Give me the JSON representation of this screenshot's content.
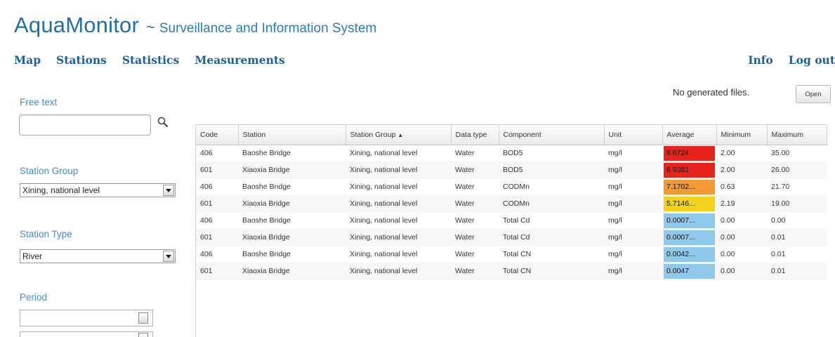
{
  "header": {
    "title": "AquaMonitor",
    "separator": "~",
    "subtitle": "Surveillance and Information System"
  },
  "nav": {
    "left": [
      "Map",
      "Stations",
      "Statistics",
      "Measurements"
    ],
    "right": [
      "Info",
      "Log out"
    ]
  },
  "sidebar": {
    "free_text": {
      "label": "Free text",
      "value": ""
    },
    "station_group": {
      "label": "Station Group",
      "value": "Xining, national level"
    },
    "station_type": {
      "label": "Station Type",
      "value": "River"
    },
    "period": {
      "label": "Period",
      "from": "",
      "to": ""
    }
  },
  "files": {
    "status": "No generated files.",
    "open_label": "Open"
  },
  "table": {
    "columns": [
      "Code",
      "Station",
      "Station Group",
      "Data type",
      "Component",
      "Unit",
      "Average",
      "Minimum",
      "Maximum"
    ],
    "sort_indicator": "▲",
    "rows": [
      {
        "code": "406",
        "station": "Baoshe Bridge",
        "group": "Xining, national level",
        "datatype": "Water",
        "component": "BOD5",
        "unit": "mg/l",
        "average": "9.6724",
        "avg_color": "#e8231b",
        "min": "2.00",
        "max": "35.00"
      },
      {
        "code": "601",
        "station": "Xiaoxia Bridge",
        "group": "Xining, national level",
        "datatype": "Water",
        "component": "BOD5",
        "unit": "mg/l",
        "average": "6.9381",
        "avg_color": "#e8231b",
        "min": "2.00",
        "max": "26.00"
      },
      {
        "code": "406",
        "station": "Baoshe Bridge",
        "group": "Xining, national level",
        "datatype": "Water",
        "component": "CODMn",
        "unit": "mg/l",
        "average": "7.1702...",
        "avg_color": "#f39a34",
        "min": "0.63",
        "max": "21.70"
      },
      {
        "code": "601",
        "station": "Xiaoxia Bridge",
        "group": "Xining, national level",
        "datatype": "Water",
        "component": "CODMn",
        "unit": "mg/l",
        "average": "5.7146...",
        "avg_color": "#f5d21c",
        "min": "2.19",
        "max": "19.00"
      },
      {
        "code": "406",
        "station": "Baoshe Bridge",
        "group": "Xining, national level",
        "datatype": "Water",
        "component": "Total Cd",
        "unit": "mg/l",
        "average": "0.0007...",
        "avg_color": "#8fcaec",
        "min": "0.00",
        "max": "0.00"
      },
      {
        "code": "601",
        "station": "Xiaoxia Bridge",
        "group": "Xining, national level",
        "datatype": "Water",
        "component": "Total Cd",
        "unit": "mg/l",
        "average": "0.0007...",
        "avg_color": "#8fcaec",
        "min": "0.00",
        "max": "0.01"
      },
      {
        "code": "406",
        "station": "Baoshe Bridge",
        "group": "Xining, national level",
        "datatype": "Water",
        "component": "Total CN",
        "unit": "mg/l",
        "average": "0.0042...",
        "avg_color": "#8fcaec",
        "min": "0.00",
        "max": "0.01"
      },
      {
        "code": "601",
        "station": "Xiaoxia Bridge",
        "group": "Xining, national level",
        "datatype": "Water",
        "component": "Total CN",
        "unit": "mg/l",
        "average": "0.0047",
        "avg_color": "#8fcaec",
        "min": "0.00",
        "max": "0.01"
      }
    ]
  },
  "colors": {
    "brand": "#1f6fa8",
    "nav": "#1f5f99",
    "label": "#3c8fc8",
    "level_high": "#e8231b",
    "level_elevated": "#f39a34",
    "level_moderate": "#f5d21c",
    "level_low": "#8fcaec"
  },
  "icons": [
    "search-icon",
    "dropdown-arrow-icon",
    "calendar-icon"
  ]
}
